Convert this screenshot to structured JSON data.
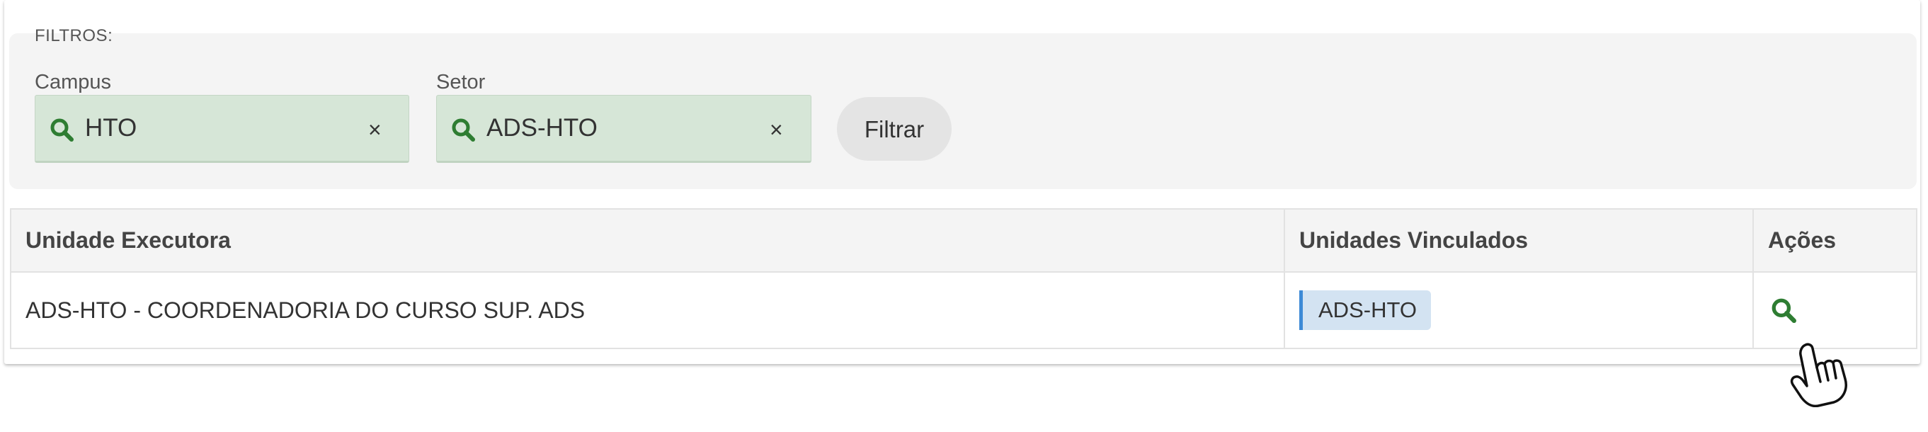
{
  "filters": {
    "title": "FILTROS:",
    "campus": {
      "label": "Campus",
      "value": "HTO",
      "clear": "×"
    },
    "setor": {
      "label": "Setor",
      "value": "ADS-HTO",
      "clear": "×"
    },
    "submit_label": "Filtrar"
  },
  "table": {
    "headers": [
      "Unidade Executora",
      "Unidades Vinculados",
      "Ações"
    ],
    "rows": [
      {
        "unidade_executora": "ADS-HTO - COORDENADORIA DO CURSO SUP. ADS",
        "unidades_vinculados": [
          "ADS-HTO"
        ],
        "action_icon": "search-icon"
      }
    ]
  },
  "colors": {
    "field_bg": "#d6e6d7",
    "icon_green": "#2e7d32",
    "tag_bg": "#d3e3f2",
    "tag_border": "#3d8ad6"
  }
}
